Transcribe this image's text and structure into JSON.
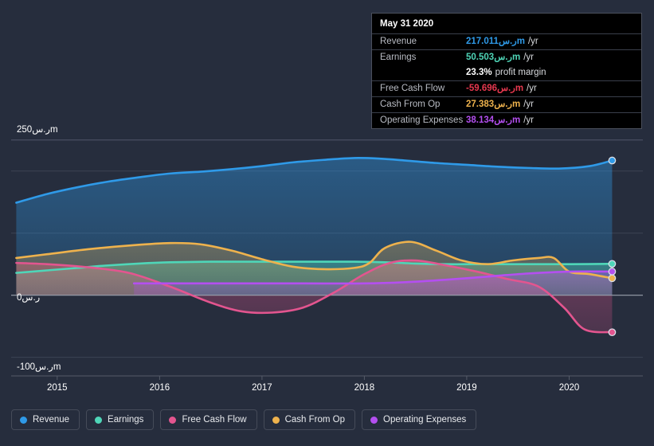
{
  "chart_data": {
    "type": "area",
    "title": "",
    "xlabel": "",
    "ylabel": "",
    "currency_suffix": "ر.سm",
    "x_tick_labels": [
      "2015",
      "2016",
      "2017",
      "2018",
      "2019",
      "2020"
    ],
    "x_tick_values": [
      2015,
      2016,
      2017,
      2018,
      2019,
      2020
    ],
    "y_tick_labels": [
      "250ر.سm",
      "0ر.س",
      "-100ر.سm"
    ],
    "y_tick_values": [
      250,
      0,
      -100
    ],
    "ylim": [
      -130,
      260
    ],
    "xlim": [
      2014.55,
      2020.72
    ],
    "grid": true,
    "legend_position": "bottom",
    "series": [
      {
        "name": "Revenue",
        "color": "#2f9ae8",
        "x": [
          2014.6,
          2014.9,
          2015.2,
          2015.5,
          2015.8,
          2016.1,
          2016.4,
          2016.7,
          2017.0,
          2017.3,
          2017.6,
          2017.9,
          2018.15,
          2018.4,
          2018.7,
          2019.0,
          2019.3,
          2019.6,
          2019.9,
          2020.2,
          2020.42
        ],
        "values": [
          149,
          163,
          174,
          183,
          190,
          196,
          199,
          203,
          208,
          214,
          218,
          221,
          220,
          217,
          213,
          210,
          207,
          205,
          204,
          208,
          217.011
        ]
      },
      {
        "name": "Earnings",
        "color": "#4fd6b8",
        "x": [
          2014.6,
          2014.9,
          2015.2,
          2015.5,
          2015.8,
          2016.1,
          2016.5,
          2017.0,
          2017.5,
          2017.9,
          2018.2,
          2018.5,
          2018.8,
          2019.1,
          2019.4,
          2019.7,
          2020.0,
          2020.42
        ],
        "values": [
          36,
          40,
          44,
          48,
          51,
          53,
          54,
          54,
          54,
          54,
          53,
          51,
          50,
          50,
          50,
          50,
          50,
          50.503
        ]
      },
      {
        "name": "Free Cash Flow",
        "color": "#e3558f",
        "x": [
          2014.6,
          2014.9,
          2015.3,
          2015.7,
          2016.1,
          2016.5,
          2016.8,
          2017.1,
          2017.4,
          2017.7,
          2018.0,
          2018.25,
          2018.5,
          2018.8,
          2019.1,
          2019.4,
          2019.7,
          2019.95,
          2020.15,
          2020.42
        ],
        "values": [
          52,
          50,
          45,
          36,
          14,
          -12,
          -26,
          -28,
          -20,
          4,
          34,
          52,
          56,
          48,
          38,
          26,
          14,
          -20,
          -55,
          -59.696
        ]
      },
      {
        "name": "Cash From Op",
        "color": "#eeb24d",
        "x": [
          2014.6,
          2014.9,
          2015.3,
          2015.7,
          2016.1,
          2016.4,
          2016.7,
          2017.0,
          2017.3,
          2017.6,
          2017.9,
          2018.05,
          2018.2,
          2018.45,
          2018.7,
          2018.95,
          2019.2,
          2019.45,
          2019.7,
          2019.85,
          2020.0,
          2020.2,
          2020.42
        ],
        "values": [
          60,
          66,
          74,
          80,
          84,
          82,
          72,
          58,
          46,
          42,
          44,
          52,
          76,
          86,
          72,
          56,
          50,
          56,
          60,
          60,
          38,
          34,
          27.383
        ]
      },
      {
        "name": "Operating Expenses",
        "color": "#b44ff0",
        "x": [
          2015.75,
          2016.2,
          2016.8,
          2017.4,
          2018.0,
          2018.4,
          2018.8,
          2019.2,
          2019.6,
          2020.0,
          2020.42
        ],
        "values": [
          19,
          19,
          19,
          19,
          19,
          21,
          25,
          30,
          35,
          38,
          38.134
        ]
      }
    ]
  },
  "tooltip": {
    "date": "May 31 2020",
    "rows": [
      {
        "name": "Revenue",
        "value": "217.011ر.سm",
        "unit": "/yr",
        "color": "#2f9ae8"
      },
      {
        "name": "Earnings",
        "value": "50.503ر.سm",
        "unit": "/yr",
        "color": "#4fd6b8"
      },
      {
        "name": "",
        "value": "23.3%",
        "unit": "profit margin",
        "color": "#ffffff"
      },
      {
        "name": "Free Cash Flow",
        "value": "-59.696ر.سm",
        "unit": "/yr",
        "color": "#e8384f"
      },
      {
        "name": "Cash From Op",
        "value": "27.383ر.سm",
        "unit": "/yr",
        "color": "#eeb24d"
      },
      {
        "name": "Operating Expenses",
        "value": "38.134ر.سm",
        "unit": "/yr",
        "color": "#b44ff0"
      }
    ]
  },
  "legend": {
    "items": [
      {
        "label": "Revenue",
        "color": "#2f9ae8"
      },
      {
        "label": "Earnings",
        "color": "#4fd6b8"
      },
      {
        "label": "Free Cash Flow",
        "color": "#e3558f"
      },
      {
        "label": "Cash From Op",
        "color": "#eeb24d"
      },
      {
        "label": "Operating Expenses",
        "color": "#b44ff0"
      }
    ]
  },
  "colors": {
    "background": "#262d3d",
    "gridline": "#3c4354",
    "zero_line": "#9aa0ad",
    "axis_line": "#555b69"
  }
}
